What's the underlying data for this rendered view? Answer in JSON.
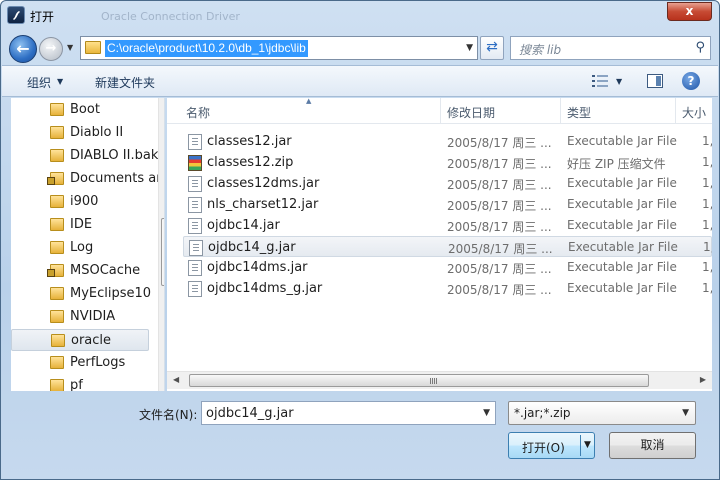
{
  "window": {
    "title": "打开",
    "ghost_title": "Oracle Connection Driver",
    "close_label": "x"
  },
  "address_bar": {
    "path": "C:\\oracle\\product\\10.2.0\\db_1\\jdbc\\lib",
    "search_placeholder": "搜索 lib"
  },
  "toolbar": {
    "organize_label": "组织",
    "new_folder_label": "新建文件夹"
  },
  "nav_pane": {
    "items": [
      {
        "label": "Boot",
        "locked": false,
        "selected": false
      },
      {
        "label": "Diablo II",
        "locked": false,
        "selected": false
      },
      {
        "label": "DIABLO II.bak",
        "locked": false,
        "selected": false
      },
      {
        "label": "Documents and",
        "locked": true,
        "selected": false
      },
      {
        "label": "i900",
        "locked": false,
        "selected": false
      },
      {
        "label": "IDE",
        "locked": false,
        "selected": false
      },
      {
        "label": "Log",
        "locked": false,
        "selected": false
      },
      {
        "label": "MSOCache",
        "locked": true,
        "selected": false
      },
      {
        "label": "MyEclipse10",
        "locked": false,
        "selected": false
      },
      {
        "label": "NVIDIA",
        "locked": false,
        "selected": false
      },
      {
        "label": "oracle",
        "locked": false,
        "selected": true
      },
      {
        "label": "PerfLogs",
        "locked": false,
        "selected": false
      },
      {
        "label": "pf",
        "locked": false,
        "selected": false
      }
    ]
  },
  "file_list": {
    "columns": {
      "name": "名称",
      "date": "修改日期",
      "type": "类型",
      "size": "大小"
    },
    "files": [
      {
        "name": "classes12.jar",
        "date": "2005/8/17 周三 ...",
        "type": "Executable Jar File",
        "size": "1,",
        "icon": "jar-file-icon",
        "selected": false
      },
      {
        "name": "classes12.zip",
        "date": "2005/8/17 周三 ...",
        "type": "好压 ZIP 压缩文件",
        "size": "1,",
        "icon": "zip-archive-icon",
        "selected": false
      },
      {
        "name": "classes12dms.jar",
        "date": "2005/8/17 周三 ...",
        "type": "Executable Jar File",
        "size": "1,",
        "icon": "jar-file-icon",
        "selected": false
      },
      {
        "name": "nls_charset12.jar",
        "date": "2005/8/17 周三 ...",
        "type": "Executable Jar File",
        "size": "1,",
        "icon": "jar-file-icon",
        "selected": false
      },
      {
        "name": "ojdbc14.jar",
        "date": "2005/8/17 周三 ...",
        "type": "Executable Jar File",
        "size": "1,",
        "icon": "jar-file-icon",
        "selected": false
      },
      {
        "name": "ojdbc14_g.jar",
        "date": "2005/8/17 周三 ...",
        "type": "Executable Jar File",
        "size": "1,",
        "icon": "jar-file-icon",
        "selected": true
      },
      {
        "name": "ojdbc14dms.jar",
        "date": "2005/8/17 周三 ...",
        "type": "Executable Jar File",
        "size": "1,",
        "icon": "jar-file-icon",
        "selected": false
      },
      {
        "name": "ojdbc14dms_g.jar",
        "date": "2005/8/17 周三 ...",
        "type": "Executable Jar File",
        "size": "1,",
        "icon": "jar-file-icon",
        "selected": false
      }
    ]
  },
  "footer": {
    "filename_label": "文件名(N):",
    "filename_value": "ojdbc14_g.jar",
    "filter_value": "*.jar;*.zip",
    "open_label": "打开(O)",
    "cancel_label": "取消"
  }
}
